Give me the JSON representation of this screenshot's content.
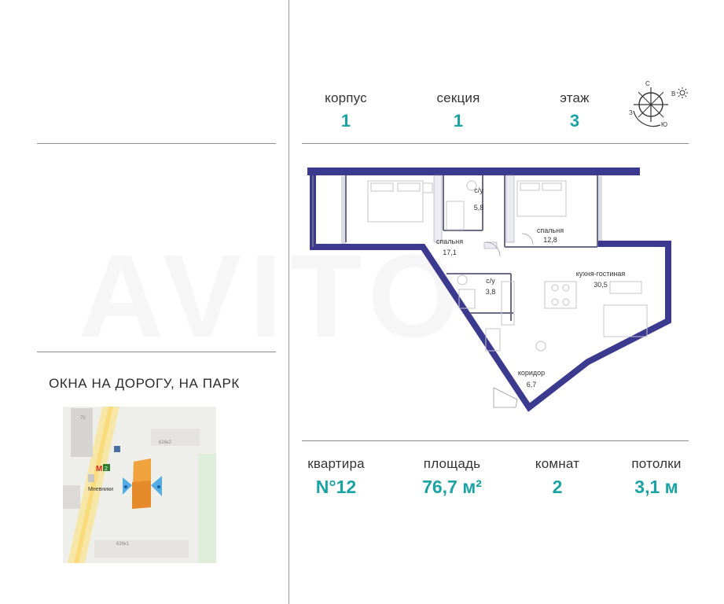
{
  "header": {
    "korpus": {
      "label": "корпус",
      "value": "1"
    },
    "sektsiya": {
      "label": "секция",
      "value": "1"
    },
    "etazh": {
      "label": "этаж",
      "value": "3"
    }
  },
  "compass": {
    "n": "С",
    "e": "В",
    "s": "Ю",
    "w": "З"
  },
  "plan": {
    "rooms": [
      {
        "name": "с/у",
        "area": "5,8"
      },
      {
        "name": "спальня",
        "area": "12,8"
      },
      {
        "name": "спальня",
        "area": "17,1"
      },
      {
        "name": "с/у",
        "area": "3,8"
      },
      {
        "name": "кухня-гостиная",
        "area": "30,5"
      },
      {
        "name": "коридор",
        "area": "6,7"
      }
    ]
  },
  "windows_caption": "ОКНА НА ДОРОГУ, НА ПАРК",
  "map": {
    "metro_letter": "M",
    "metro_line": "2",
    "metro_station": "Мневники",
    "buildings": [
      "626к2",
      "626к1",
      "70"
    ]
  },
  "footer": {
    "kvartira": {
      "label": "квартира",
      "value": "N°12"
    },
    "ploshchad": {
      "label": "площадь",
      "value": "76,7 м²"
    },
    "komnat": {
      "label": "комнат",
      "value": "2"
    },
    "potolki": {
      "label": "потолки",
      "value": "3,1 м"
    }
  },
  "colors": {
    "accent": "#1aa3a3",
    "wall": "#3b3a8f",
    "apartment": "#f0a23c"
  }
}
